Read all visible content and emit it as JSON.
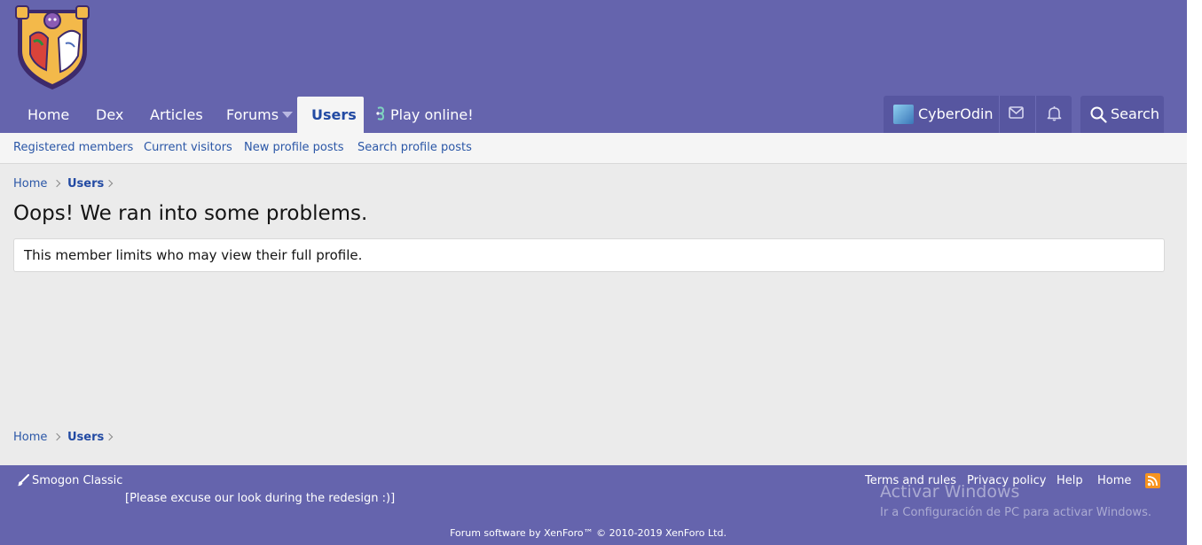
{
  "header": {
    "nav": {
      "home": "Home",
      "dex": "Dex",
      "articles": "Articles",
      "forums": "Forums",
      "users": "Users",
      "play_online": "Play online!"
    },
    "user": {
      "name": "CyberOdin"
    },
    "search_label": "Search"
  },
  "subnav": {
    "registered_members": "Registered members",
    "current_visitors": "Current visitors",
    "new_profile_posts": "New profile posts",
    "search_profile_posts": "Search profile posts"
  },
  "breadcrumb": {
    "home": "Home",
    "users": "Users"
  },
  "main": {
    "title": "Oops! We ran into some problems.",
    "message": "This member limits who may view their full profile."
  },
  "footer": {
    "style_name": "Smogon Classic",
    "redesign_note": "[Please excuse our look during the redesign :)]",
    "links": {
      "terms": "Terms and rules",
      "privacy": "Privacy policy",
      "help": "Help",
      "home": "Home"
    },
    "copyright": "Forum software by XenForo™ © 2010-2019 XenForo Ltd."
  },
  "watermark": {
    "title": "Activar Windows",
    "subtitle": "Ir a Configuración de PC para activar Windows."
  },
  "colors": {
    "header_bg": "#6564ad",
    "accent": "#224aa3",
    "link": "#2b57a7",
    "page_bg": "#ebebeb"
  },
  "icons": [
    "site-logo-icon",
    "play-icon",
    "forums-caret-icon",
    "avatar",
    "mail-icon",
    "bell-icon",
    "search-icon",
    "chevron-right-icon",
    "brush-icon",
    "rss-icon"
  ]
}
